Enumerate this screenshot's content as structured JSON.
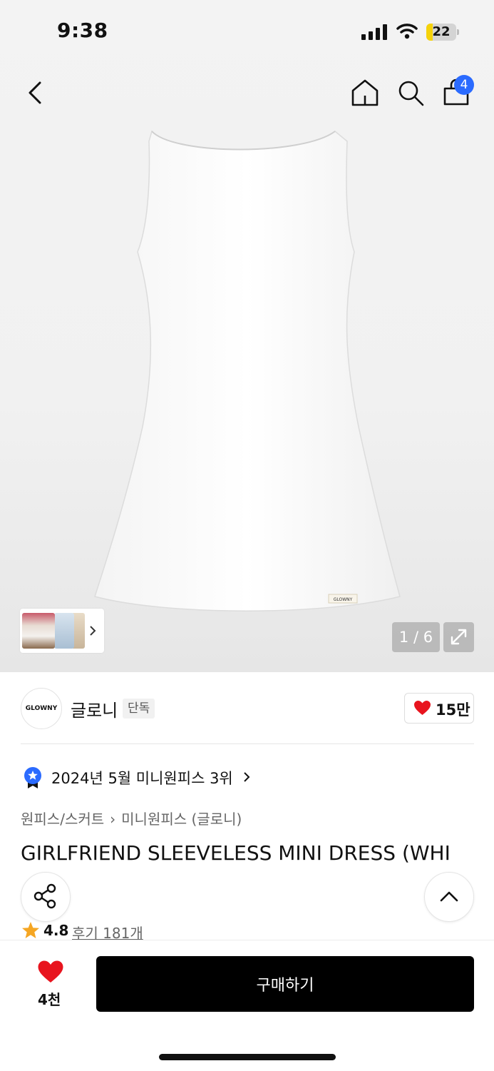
{
  "status_bar": {
    "time": "9:38",
    "battery_level": "22",
    "battery_fraction": 0.22
  },
  "header": {
    "cart_count": "4"
  },
  "gallery": {
    "counter": "1 / 6"
  },
  "brand": {
    "logo_text": "GLOWNY",
    "name": "글로니",
    "tag": "단독",
    "likes": "15만"
  },
  "ranking": {
    "text": "2024년 5월 미니원피스 3위"
  },
  "breadcrumb": {
    "category": "원피스/스커트",
    "subcategory": "미니원피스 (글로니)"
  },
  "product": {
    "title": "GIRLFRIEND SLEEVELESS MINI DRESS (WHI",
    "rating": "4.8",
    "reviews": "후기 181개"
  },
  "bottom": {
    "wish_count": "4천",
    "buy_label": "구매하기"
  },
  "colors": {
    "accent_blue": "#2b6bff",
    "heart_red": "#e8141e",
    "star": "#f5a623"
  }
}
